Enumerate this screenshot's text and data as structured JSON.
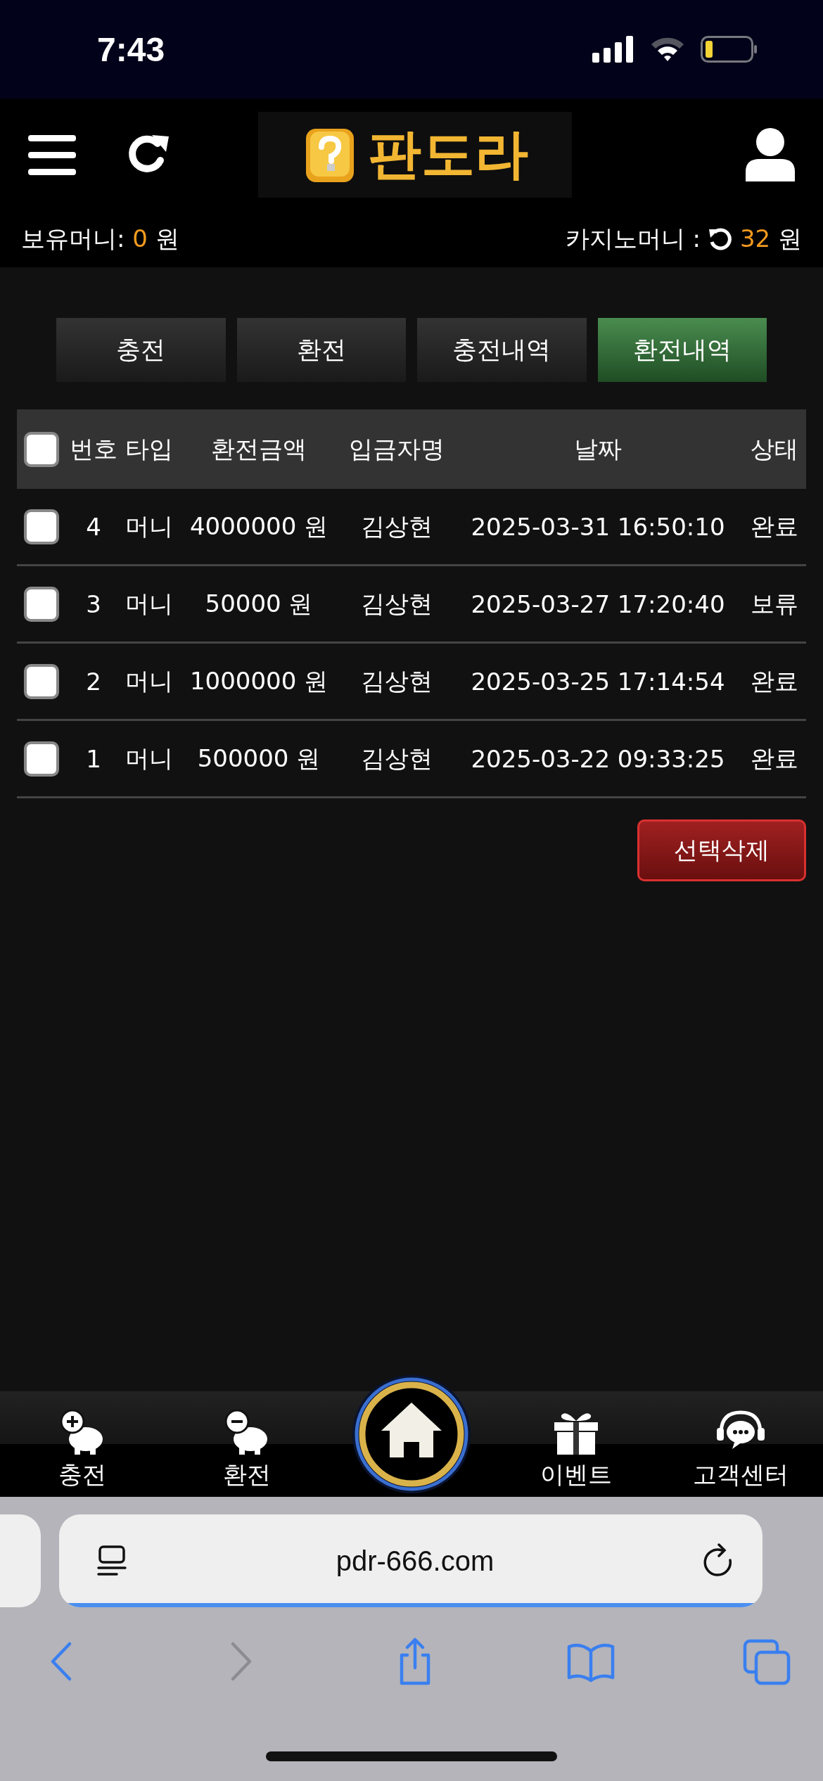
{
  "status_bar": {
    "time": "7:43"
  },
  "header": {
    "logo": "판도라",
    "balance_label": "보유머니:",
    "balance_value": "0",
    "balance_unit": "원",
    "casino_label": "카지노머니 :",
    "casino_value": "32",
    "casino_unit": "원"
  },
  "tabs": [
    {
      "label": "충전",
      "selected": false
    },
    {
      "label": "환전",
      "selected": false
    },
    {
      "label": "충전내역",
      "selected": false
    },
    {
      "label": "환전내역",
      "selected": true
    }
  ],
  "table": {
    "select_all_checked": false,
    "columns": [
      "번호",
      "타입",
      "환전금액",
      "입금자명",
      "날짜",
      "상태"
    ],
    "rows": [
      {
        "checked": false,
        "cells": [
          "4",
          "머니",
          "4000000 원",
          "김상현",
          "2025-03-31 16:50:10",
          "완료"
        ]
      },
      {
        "checked": false,
        "cells": [
          "3",
          "머니",
          "50000 원",
          "김상현",
          "2025-03-27 17:20:40",
          "보류"
        ]
      },
      {
        "checked": false,
        "cells": [
          "2",
          "머니",
          "1000000 원",
          "김상현",
          "2025-03-25 17:14:54",
          "완료"
        ]
      },
      {
        "checked": false,
        "cells": [
          "1",
          "머니",
          "500000 원",
          "김상현",
          "2025-03-22 09:33:25",
          "완료"
        ]
      }
    ]
  },
  "delete_button": "선택삭제",
  "bottom_nav": [
    {
      "kind": "deposit",
      "label": "충전"
    },
    {
      "kind": "withdraw",
      "label": "환전"
    },
    {
      "kind": "home"
    },
    {
      "kind": "event",
      "label": "이벤트"
    },
    {
      "kind": "support",
      "label": "고객센터"
    }
  ],
  "browser": {
    "url": "pdr-666.com",
    "load": {
      "level": 1
    },
    "toolbar": [
      {
        "kind": "back",
        "disabled": false
      },
      {
        "kind": "forward",
        "disabled": true
      },
      {
        "kind": "share",
        "disabled": false
      },
      {
        "kind": "bookmarks",
        "disabled": false
      },
      {
        "kind": "tabs",
        "disabled": false
      }
    ]
  }
}
